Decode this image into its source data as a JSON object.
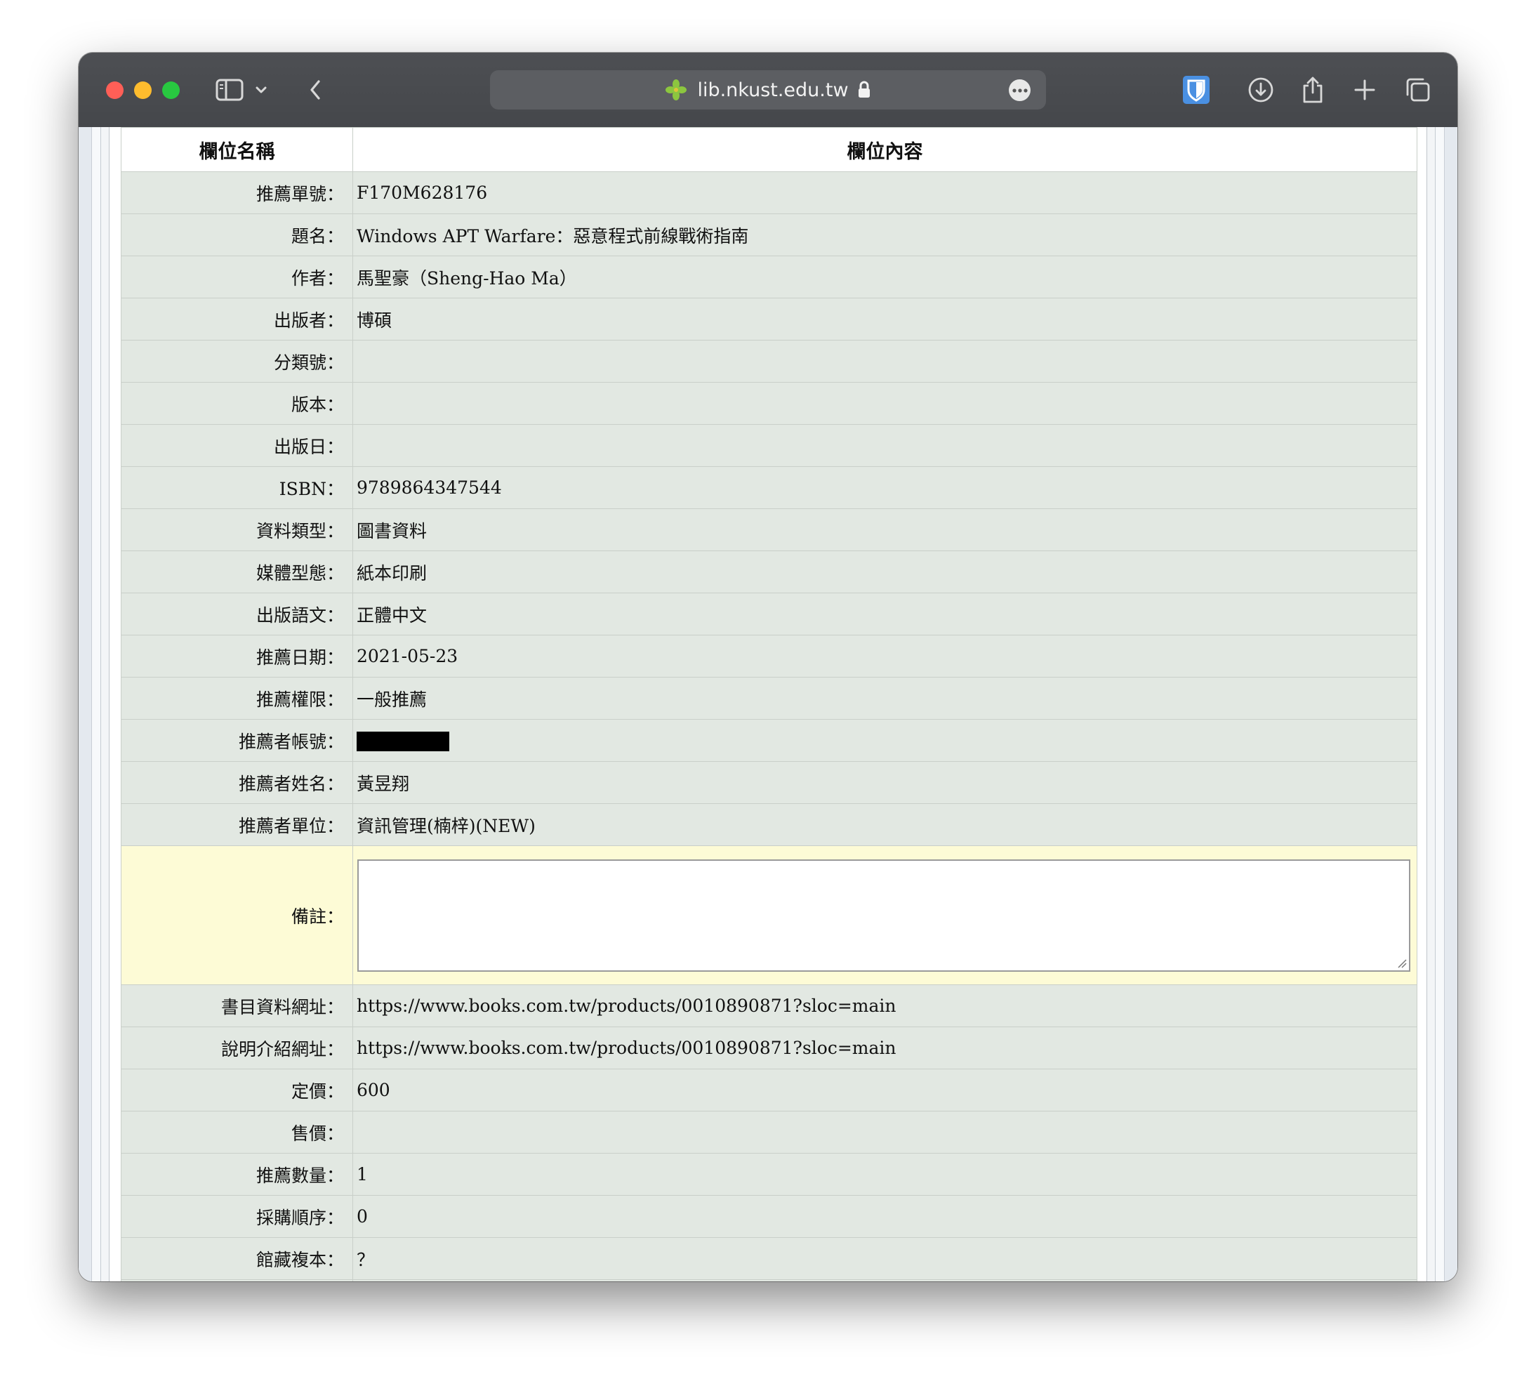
{
  "browser": {
    "url": "lib.nkust.edu.tw",
    "colors": {
      "chrome": "#48494d",
      "address_bar": "#5c5e62",
      "accent_shield": "#4a90e2"
    }
  },
  "table": {
    "headers": {
      "field_name": "欄位名稱",
      "field_content": "欄位內容"
    },
    "rows": [
      {
        "label": "推薦單號：",
        "value": "F170M628176"
      },
      {
        "label": "題名：",
        "value": "Windows APT Warfare：惡意程式前線戰術指南"
      },
      {
        "label": "作者：",
        "value": "馬聖豪（Sheng-Hao Ma）"
      },
      {
        "label": "出版者：",
        "value": "博碩"
      },
      {
        "label": "分類號：",
        "value": ""
      },
      {
        "label": "版本：",
        "value": ""
      },
      {
        "label": "出版日：",
        "value": ""
      },
      {
        "label": "ISBN：",
        "value": "9789864347544"
      },
      {
        "label": "資料類型：",
        "value": "圖書資料"
      },
      {
        "label": "媒體型態：",
        "value": "紙本印刷"
      },
      {
        "label": "出版語文：",
        "value": "正體中文"
      },
      {
        "label": "推薦日期：",
        "value": "2021-05-23"
      },
      {
        "label": "推薦權限：",
        "value": "一般推薦"
      },
      {
        "label": "推薦者帳號：",
        "value": ""
      },
      {
        "label": "推薦者姓名：",
        "value": "黃昱翔"
      },
      {
        "label": "推薦者單位：",
        "value": "資訊管理(楠梓)(NEW)"
      }
    ],
    "note": {
      "label": "備註：",
      "value": ""
    },
    "rows2": [
      {
        "label": "書目資料網址：",
        "value": "https://www.books.com.tw/products/0010890871?sloc=main"
      },
      {
        "label": "說明介紹網址：",
        "value": "https://www.books.com.tw/products/0010890871?sloc=main"
      },
      {
        "label": "定價：",
        "value": "600"
      },
      {
        "label": "售價：",
        "value": ""
      },
      {
        "label": "推薦數量：",
        "value": "1"
      },
      {
        "label": "採購順序：",
        "value": "0"
      },
      {
        "label": "館藏複本：",
        "value": "？"
      }
    ]
  }
}
